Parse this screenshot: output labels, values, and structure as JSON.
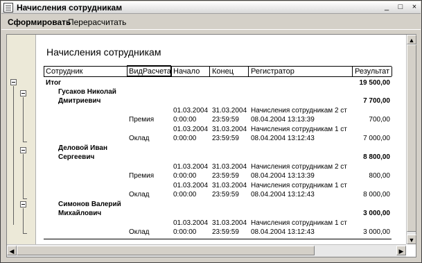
{
  "window": {
    "title": "Начисления сотрудникам",
    "controls": [
      "_",
      "□",
      "×"
    ]
  },
  "toolbar": {
    "generate_label": "Сформировать",
    "recalc_label": "Перерасчитать"
  },
  "report": {
    "title": "Начисления сотрудникам",
    "columns": [
      "Сотрудник",
      "ВидРасчета",
      "Начало",
      "Конец",
      "Регистратор",
      "Результат"
    ],
    "total_label": "Итог",
    "total_value": "19 500,00",
    "employees": [
      {
        "name_line1": "Гусаков Николай",
        "name_line2": "Дмитриевич",
        "total": "7 700,00",
        "rows": [
          {
            "type": "Премия",
            "start_date": "01.03.2004",
            "start_time": "0:00:00",
            "end_date": "31.03.2004",
            "end_time": "23:59:59",
            "reg_line1": "Начисления сотрудникам 2 ст",
            "reg_line2": "08.04.2004 13:13:39",
            "result": "700,00"
          },
          {
            "type": "Оклад",
            "start_date": "01.03.2004",
            "start_time": "0:00:00",
            "end_date": "31.03.2004",
            "end_time": "23:59:59",
            "reg_line1": "Начисления сотрудникам 1 ст",
            "reg_line2": "08.04.2004 13:12:43",
            "result": "7 000,00"
          }
        ]
      },
      {
        "name_line1": "Деловой Иван",
        "name_line2": "Сергеевич",
        "total": "8 800,00",
        "rows": [
          {
            "type": "Премия",
            "start_date": "01.03.2004",
            "start_time": "0:00:00",
            "end_date": "31.03.2004",
            "end_time": "23:59:59",
            "reg_line1": "Начисления сотрудникам 2 ст",
            "reg_line2": "08.04.2004 13:13:39",
            "result": "800,00"
          },
          {
            "type": "Оклад",
            "start_date": "01.03.2004",
            "start_time": "0:00:00",
            "end_date": "31.03.2004",
            "end_time": "23:59:59",
            "reg_line1": "Начисления сотрудникам 1 ст",
            "reg_line2": "08.04.2004 13:12:43",
            "result": "8 000,00"
          }
        ]
      },
      {
        "name_line1": "Симонов Валерий",
        "name_line2": "Михайлович",
        "total": "3 000,00",
        "rows": [
          {
            "type": "Оклад",
            "start_date": "01.03.2004",
            "start_time": "0:00:00",
            "end_date": "31.03.2004",
            "end_time": "23:59:59",
            "reg_line1": "Начисления сотрудникам 1 ст",
            "reg_line2": "08.04.2004 13:12:43",
            "result": "3 000,00"
          }
        ]
      }
    ]
  }
}
